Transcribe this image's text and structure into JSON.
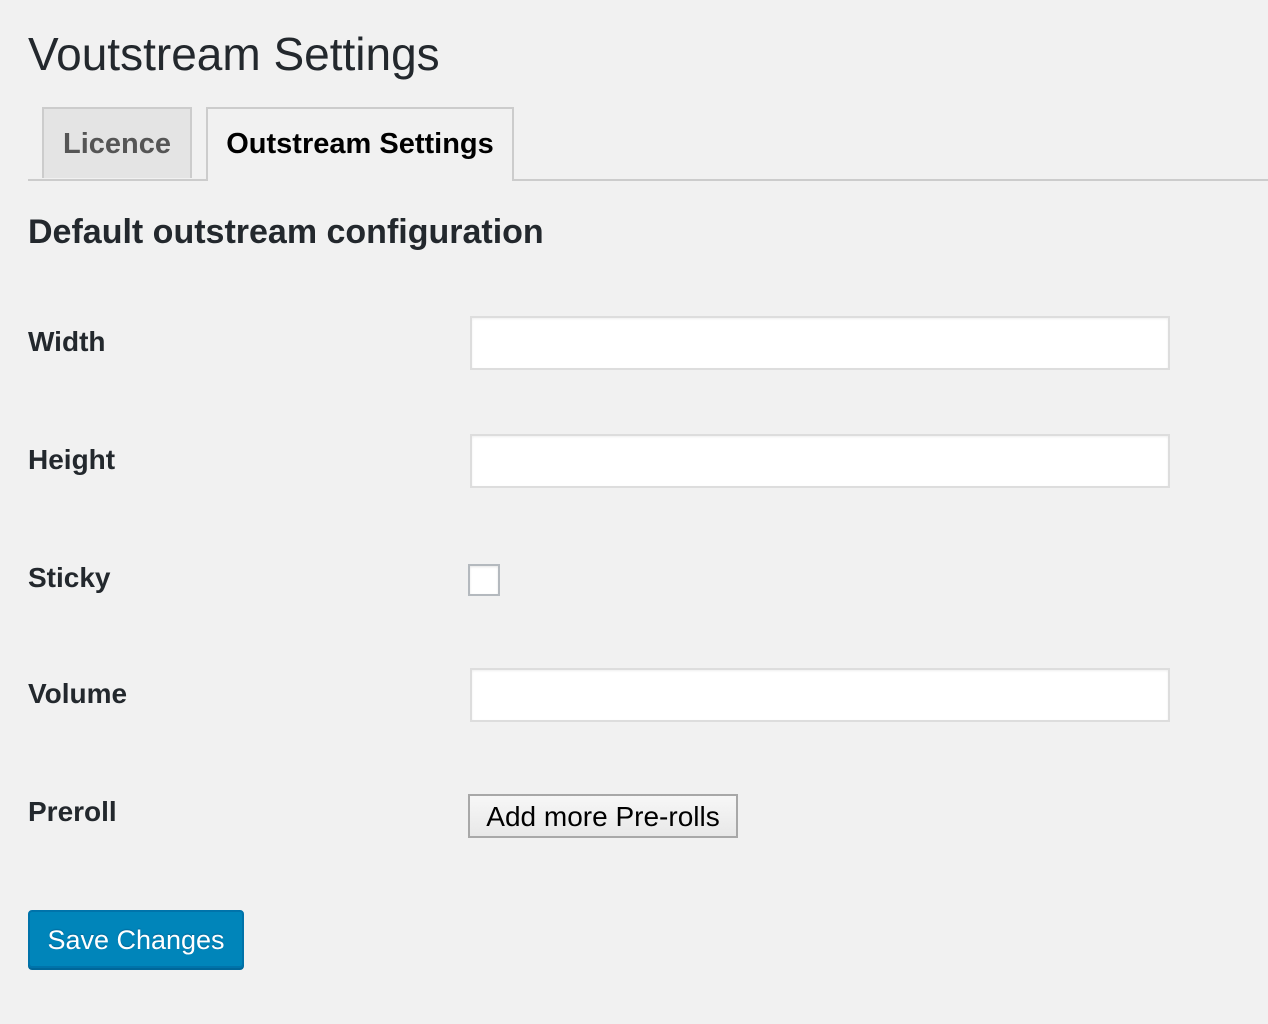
{
  "page": {
    "title": "Voutstream Settings"
  },
  "tabs": [
    {
      "label": "Licence",
      "active": false
    },
    {
      "label": "Outstream Settings",
      "active": true
    }
  ],
  "section": {
    "title": "Default outstream configuration"
  },
  "fields": {
    "width": {
      "label": "Width",
      "value": "",
      "placeholder": ""
    },
    "height": {
      "label": "Height",
      "value": "",
      "placeholder": ""
    },
    "sticky": {
      "label": "Sticky",
      "checked": false
    },
    "volume": {
      "label": "Volume",
      "value": "",
      "placeholder": ""
    },
    "preroll": {
      "label": "Preroll",
      "button_label": "Add more Pre-rolls"
    }
  },
  "actions": {
    "save_label": "Save Changes"
  },
  "colors": {
    "background": "#f1f1f1",
    "primary": "#0085ba",
    "text": "#23282d"
  }
}
